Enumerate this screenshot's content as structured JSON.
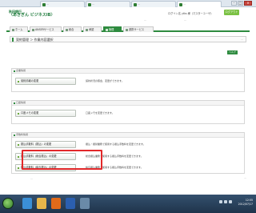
{
  "browser": {
    "tabs": [
      {
        "label": "..."
      },
      {
        "label": "..."
      },
      {
        "label": "..."
      },
      {
        "label": "..."
      }
    ]
  },
  "header": {
    "logo_line1": "秋田銀行",
    "logo_line2": "〈あきぎん ビジネスIB〉",
    "user_info": "ログイン名 ytks 様（マスターユーザ）",
    "logout_label": "ログアウト",
    "sub_info_1": "...",
    "sub_info_2": "..."
  },
  "nav": {
    "items": [
      {
        "label": "ホーム"
      },
      {
        "label": "ANSERサービス"
      },
      {
        "label": "総合"
      },
      {
        "label": "承認"
      },
      {
        "label": "管理"
      },
      {
        "label": "連携サービス"
      }
    ]
  },
  "page": {
    "title": "契約管理 ＞ 作業内容選択",
    "screen_id": "...",
    "help_label": "ヘルプ"
  },
  "sections": [
    {
      "heading": "企業情報",
      "rows": [
        {
          "button": "契約情報の変更",
          "desc": "契約状況の照会、変更ができます。"
        }
      ]
    },
    {
      "heading": "口座情報",
      "rows": [
        {
          "button": "口座メモの変更",
          "desc": "口座メモを変更できます。"
        }
      ]
    },
    {
      "heading": "手数料情報",
      "rows": [
        {
          "button": "振込手数料（振込）の変更",
          "desc": "振込・振替業務で使用する振込手数料を変更できます。"
        },
        {
          "button": "振込手数料（総合振込）の変更",
          "desc": "総合振込業務で使用する振込手数料を変更できます。"
        },
        {
          "button": "振込手数料（給与振込）の変更",
          "desc": "給与振込業務で使用する振込手数料を変更できます。"
        }
      ]
    }
  ],
  "footer": {
    "text": "...",
    "copyright": "..."
  },
  "taskbar": {
    "time": "12:55",
    "date": "2012/07/17"
  },
  "colors": {
    "brand_green": "#2e8b3f",
    "highlight_red": "#e2282a",
    "logout_green": "#7ac143"
  }
}
